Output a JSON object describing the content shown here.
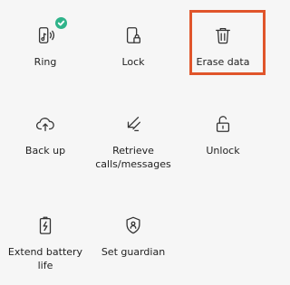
{
  "actions": {
    "ring": {
      "label": "Ring",
      "icon": "phone-sound-icon",
      "active": true
    },
    "lock": {
      "label": "Lock",
      "icon": "phone-lock-icon"
    },
    "erase": {
      "label": "Erase data",
      "icon": "trash-icon",
      "highlighted": true
    },
    "backup": {
      "label": "Back up",
      "icon": "cloud-upload-icon"
    },
    "retrieve": {
      "label": "Retrieve calls/messages",
      "icon": "retrieve-arrows-icon"
    },
    "unlock": {
      "label": "Unlock",
      "icon": "unlock-icon"
    },
    "battery": {
      "label": "Extend battery life",
      "icon": "battery-icon"
    },
    "guardian": {
      "label": "Set guardian",
      "icon": "shield-icon"
    }
  },
  "colors": {
    "background": "#f6f6f6",
    "highlight": "#e0552b",
    "badge": "#2fb38a"
  }
}
